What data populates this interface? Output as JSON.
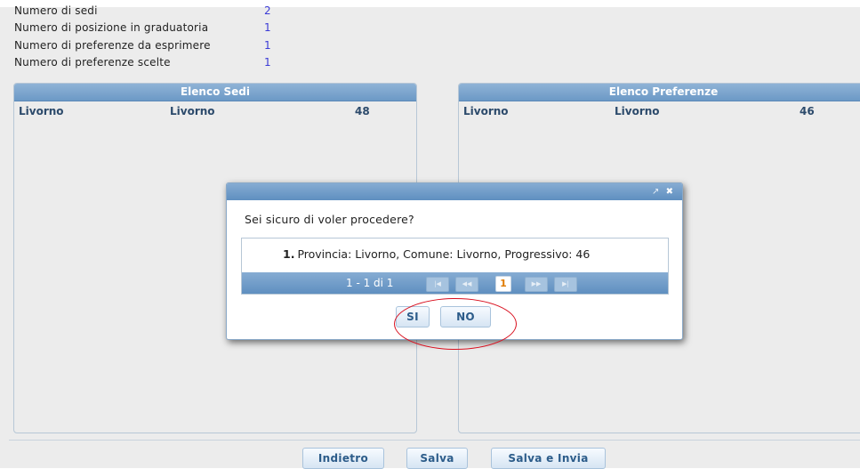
{
  "info": [
    {
      "label": "Numero di sedi",
      "value": "2"
    },
    {
      "label": "Numero di posizione in graduatoria",
      "value": "1"
    },
    {
      "label": "Numero di preferenze da esprimere",
      "value": "1"
    },
    {
      "label": "Numero di preferenze scelte",
      "value": "1"
    }
  ],
  "sedi": {
    "title": "Elenco Sedi",
    "rows": [
      {
        "provincia": "Livorno",
        "comune": "Livorno",
        "progressivo": "48"
      }
    ]
  },
  "preferenze": {
    "title": "Elenco Preferenze",
    "rows": [
      {
        "provincia": "Livorno",
        "comune": "Livorno",
        "progressivo": "46"
      }
    ]
  },
  "dialog": {
    "message": "Sei sicuro di voler procedere?",
    "item_number": "1.",
    "item_text": "Provincia: Livorno, Comune: Livorno, Progressivo: 46",
    "paginator": {
      "info": "1 - 1 di 1",
      "current_page": "1",
      "first_icon": "first-page-icon",
      "prev_icon": "prev-page-icon",
      "next_icon": "next-page-icon",
      "last_icon": "last-page-icon"
    },
    "yes_label": "SI",
    "no_label": "NO"
  },
  "footer": {
    "back_label": "Indietro",
    "save_label": "Salva",
    "save_send_label": "Salva e Invia"
  },
  "colors": {
    "header_blue": "#6c99c6",
    "link_value": "#3b3bd6",
    "annotation_red": "#d9101f"
  }
}
